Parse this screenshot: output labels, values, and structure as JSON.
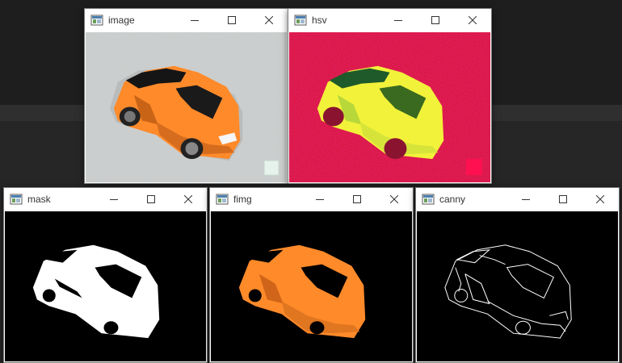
{
  "colors": {
    "desktop": "#2b2b2b",
    "car_orange": "#ff8a2a",
    "hsv_red": "#e0103c",
    "hsv_yellow": "#f2f23a",
    "mask_white": "#ffffff",
    "canvas_black": "#000000"
  },
  "windows": {
    "image": {
      "title": "image",
      "icons": [
        "app-icon",
        "minimize-icon",
        "maximize-icon",
        "close-icon"
      ]
    },
    "hsv": {
      "title": "hsv",
      "icons": [
        "app-icon",
        "minimize-icon",
        "maximize-icon",
        "close-icon"
      ]
    },
    "mask": {
      "title": "mask",
      "icons": [
        "app-icon",
        "minimize-icon",
        "maximize-icon",
        "close-icon"
      ]
    },
    "fimg": {
      "title": "fimg",
      "icons": [
        "app-icon",
        "minimize-icon",
        "maximize-icon",
        "close-icon"
      ]
    },
    "canny": {
      "title": "canny",
      "icons": [
        "app-icon",
        "minimize-icon",
        "maximize-icon",
        "close-icon"
      ]
    }
  }
}
